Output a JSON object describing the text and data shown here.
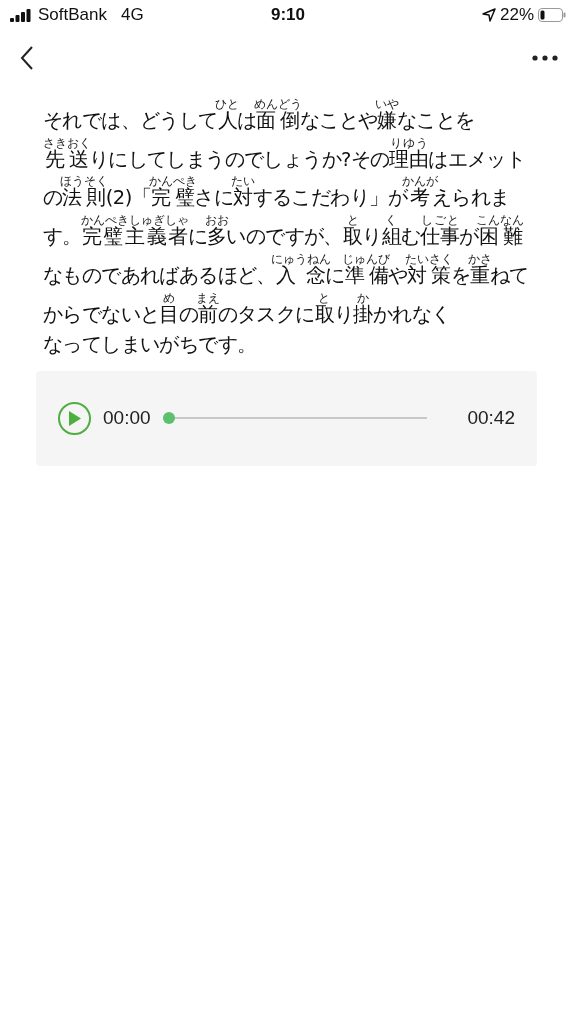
{
  "status_bar": {
    "carrier": "SoftBank",
    "network": "4G",
    "time": "9:10",
    "battery": "22%"
  },
  "article": {
    "lines": [
      [
        {
          "t": "それでは、どうして"
        },
        {
          "t": "人",
          "r": "ひと"
        },
        {
          "t": "は"
        },
        {
          "t": "面倒",
          "r": "めんどう"
        },
        {
          "t": "なことや"
        },
        {
          "t": "嫌",
          "r": "いや"
        },
        {
          "t": "なことを"
        }
      ],
      [
        {
          "t": "先送",
          "r": "さきおく"
        },
        {
          "t": "りにしてしまうのでしょうか?その"
        },
        {
          "t": "理由",
          "r": "りゆう"
        },
        {
          "t": "はエメット"
        }
      ],
      [
        {
          "t": "の"
        },
        {
          "t": "法則",
          "r": "ほうそく"
        },
        {
          "t": "(2)「"
        },
        {
          "t": "完璧",
          "r": "かんぺき"
        },
        {
          "t": "さに"
        },
        {
          "t": "対",
          "r": "たい"
        },
        {
          "t": "するこだわり」が"
        },
        {
          "t": "考",
          "r": "かんが"
        },
        {
          "t": "えられま"
        }
      ],
      [
        {
          "t": "す。"
        },
        {
          "t": "完璧主義者",
          "r": "かんぺきしゅぎしゃ"
        },
        {
          "t": "に"
        },
        {
          "t": "多",
          "r": "おお"
        },
        {
          "t": "いのですが、"
        },
        {
          "t": "取",
          "r": "と"
        },
        {
          "t": "り"
        },
        {
          "t": "組",
          "r": "く"
        },
        {
          "t": "む"
        },
        {
          "t": "仕事",
          "r": "しごと"
        },
        {
          "t": "が"
        },
        {
          "t": "困難",
          "r": "こんなん"
        }
      ],
      [
        {
          "t": "なものであればあるほど、"
        },
        {
          "t": "入念",
          "r": "にゅうねん"
        },
        {
          "t": "に"
        },
        {
          "t": "準備",
          "r": "じゅんび"
        },
        {
          "t": "や"
        },
        {
          "t": "対策",
          "r": "たいさく"
        },
        {
          "t": "を"
        },
        {
          "t": "重",
          "r": "かさ"
        },
        {
          "t": "ねて"
        }
      ],
      [
        {
          "t": "からでないと"
        },
        {
          "t": "目",
          "r": "め"
        },
        {
          "t": "の"
        },
        {
          "t": "前",
          "r": "まえ"
        },
        {
          "t": "のタスクに"
        },
        {
          "t": "取",
          "r": "と"
        },
        {
          "t": "り"
        },
        {
          "t": "掛",
          "r": "か"
        },
        {
          "t": "かれなく"
        }
      ],
      [
        {
          "t": "なってしまいがちです。"
        }
      ]
    ]
  },
  "audio": {
    "current": "00:00",
    "duration": "00:42",
    "playing": false,
    "level": 0
  }
}
